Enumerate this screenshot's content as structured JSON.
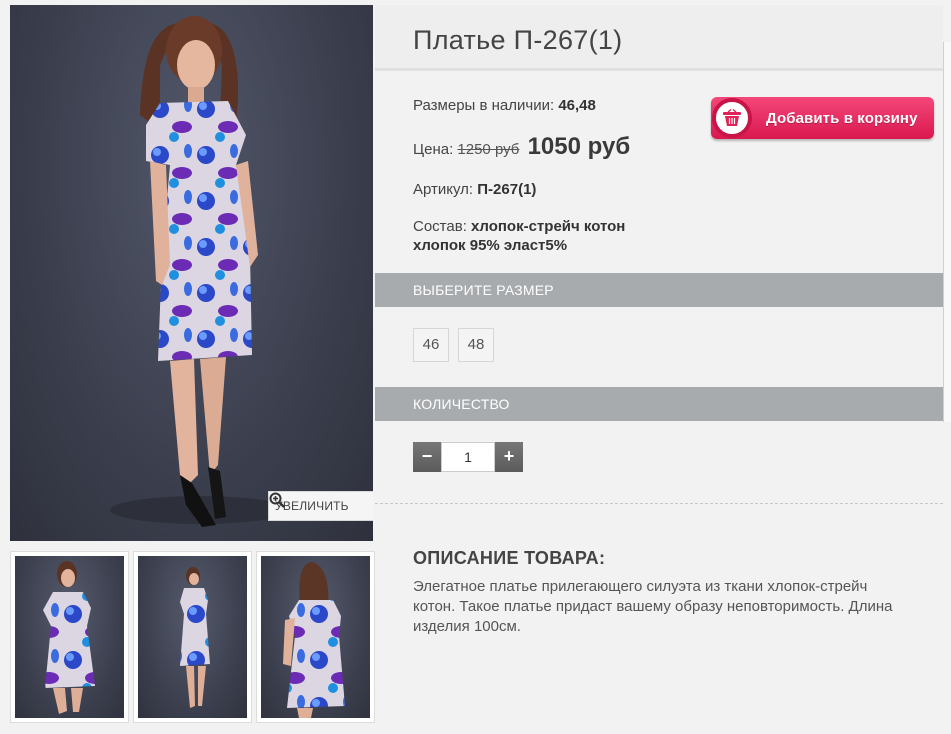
{
  "product": {
    "title": "Платье П-267(1)",
    "sizes_label": "Размеры в наличии:",
    "sizes_value": "46,48",
    "price_label": "Цена:",
    "old_price": "1250 руб",
    "new_price": "1050 руб",
    "sku_label": "Артикул:",
    "sku_value": "П-267(1)",
    "composition_label": "Состав:",
    "composition_line1": "хлопок-стрейч котон",
    "composition_line2": "хлопок 95% эласт5%"
  },
  "cart": {
    "label": "Добавить в корзину",
    "icon": "basket-icon",
    "color": "#e8265c"
  },
  "gallery": {
    "zoom_label": "УВЕЛИЧИТЬ",
    "zoom_icon": "magnifier-plus-icon"
  },
  "size_section": {
    "title": "ВЫБЕРИТЕ РАЗМЕР",
    "options": [
      "46",
      "48"
    ]
  },
  "quantity_section": {
    "title": "КОЛИЧЕСТВО",
    "minus": "−",
    "plus": "+",
    "value": "1"
  },
  "description": {
    "title": "ОПИСАНИЕ ТОВАРА:",
    "text": "Элегатное платье прилегающего силуэта из ткани хлопок-стрейч котон. Такое платье придаст вашему образу неповторимость. Длина изделия 100см."
  },
  "colors": {
    "section_bar": "#a7abae",
    "photo_background": "#3c404f"
  }
}
